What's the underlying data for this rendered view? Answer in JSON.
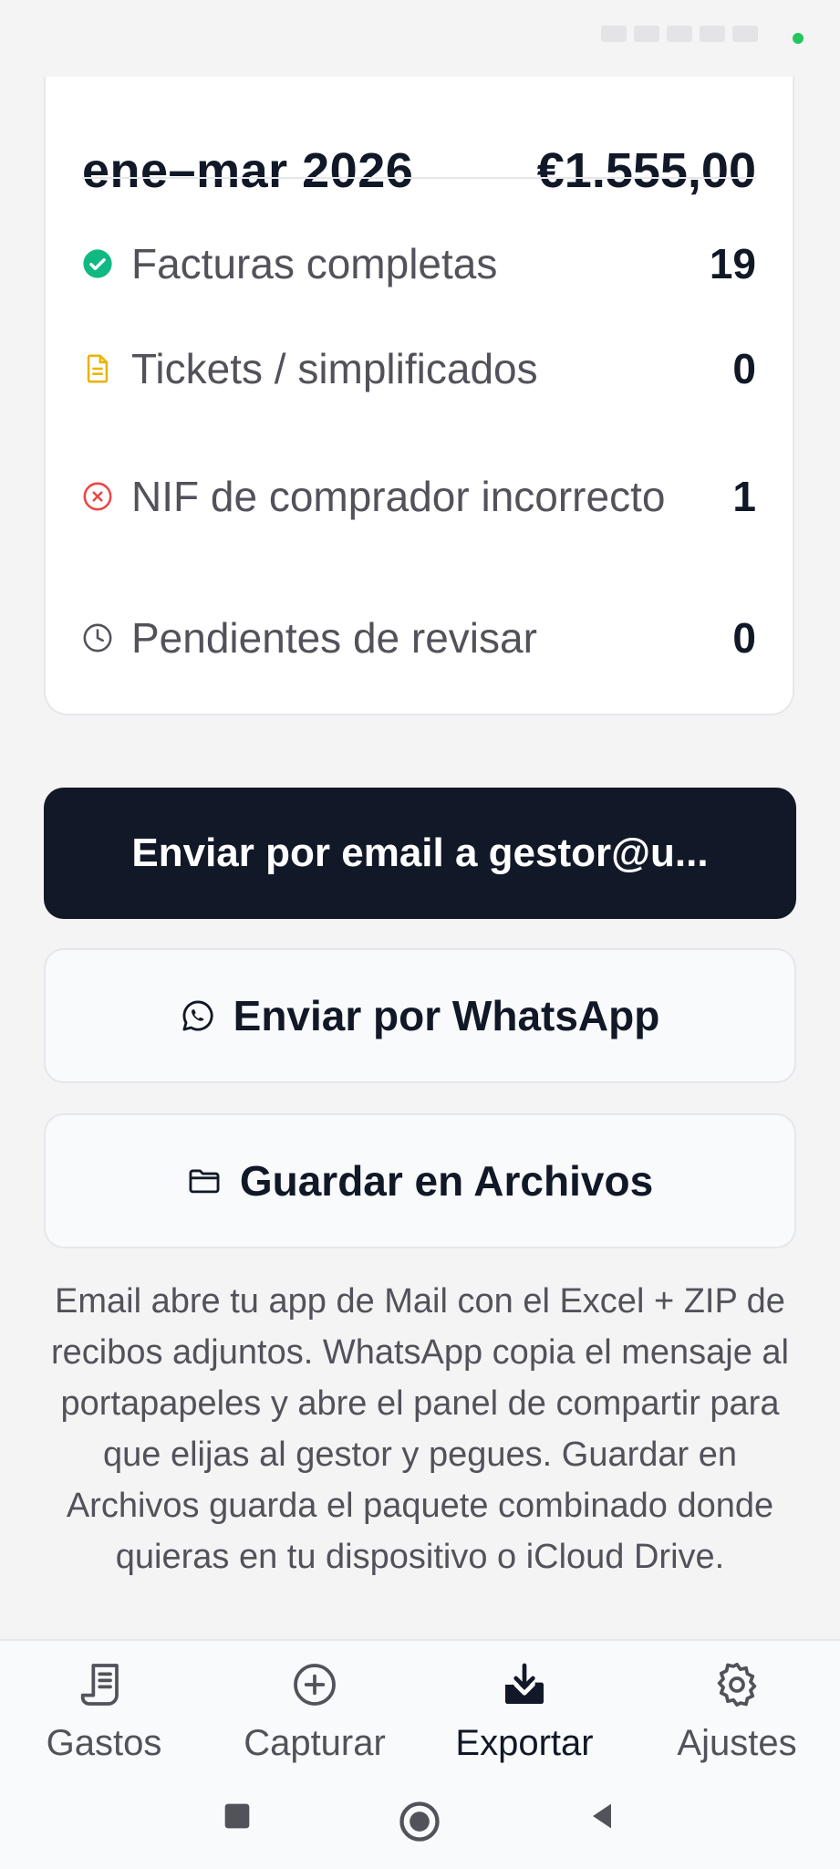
{
  "summary": {
    "period": "ene–mar 2026",
    "total": "€1.555,00",
    "rows": [
      {
        "label": "Facturas completas",
        "count": "19",
        "icon": "check-circle-icon",
        "color": "#10b981"
      },
      {
        "label": "Tickets / simplificados",
        "count": "0",
        "icon": "document-icon",
        "color": "#eab308"
      },
      {
        "label": "NIF de comprador incorrecto",
        "count": "1",
        "icon": "x-circle-icon",
        "color": "#ef4444"
      },
      {
        "label": "Pendientes de revisar",
        "count": "0",
        "icon": "clock-icon",
        "color": "#52525b"
      }
    ]
  },
  "actions": {
    "email_label": "Enviar por email a gestor@u...",
    "whatsapp_label": "Enviar por WhatsApp",
    "files_label": "Guardar en Archivos"
  },
  "note": "Email abre tu app de Mail con el Excel + ZIP de recibos adjuntos. WhatsApp copia el mensaje al portapapeles y abre el panel de compartir para que elijas al gestor y pegues. Guardar en Archivos guarda el paquete combinado donde quieras en tu dispositivo o iCloud Drive.",
  "tabs": [
    {
      "label": "Gastos",
      "icon": "receipt-icon",
      "active": false
    },
    {
      "label": "Capturar",
      "icon": "plus-circle-icon",
      "active": false
    },
    {
      "label": "Exportar",
      "icon": "export-icon",
      "active": true
    },
    {
      "label": "Ajustes",
      "icon": "gear-icon",
      "active": false
    }
  ],
  "colors": {
    "primary": "#111827",
    "success": "#10b981",
    "warning": "#eab308",
    "danger": "#ef4444"
  }
}
